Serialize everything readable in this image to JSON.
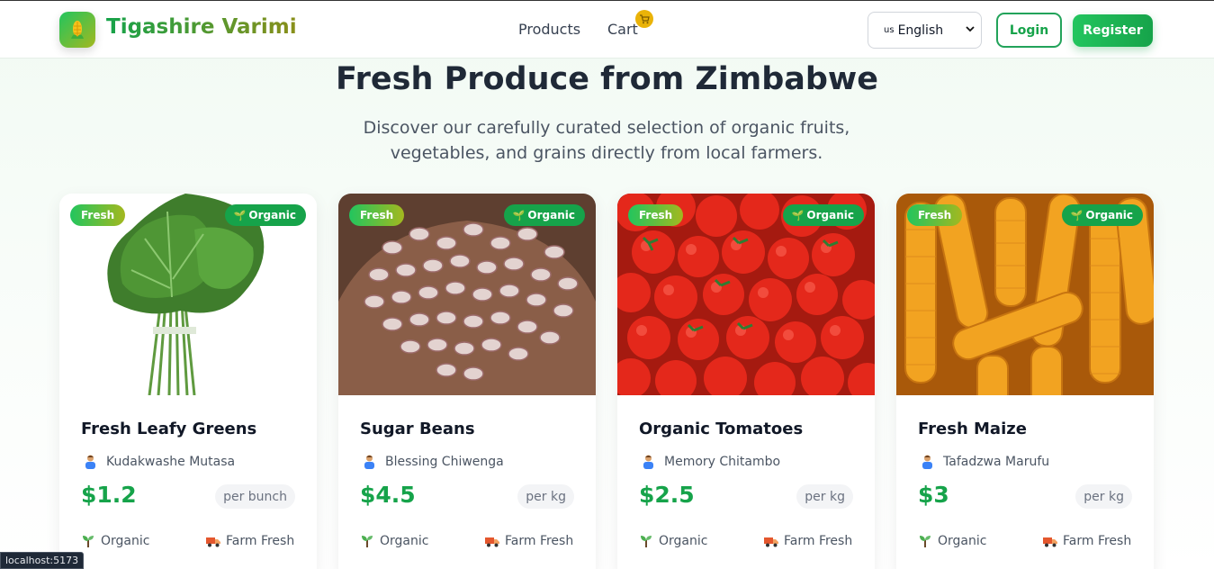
{
  "header": {
    "brand": "Tigashire Varimi",
    "nav": {
      "products": "Products",
      "cart": "Cart"
    },
    "language": {
      "code": "us",
      "selected": "English"
    },
    "login": "Login",
    "register": "Register"
  },
  "hero": {
    "title": "Fresh Produce from Zimbabwe",
    "subtitle": "Discover our carefully curated selection of organic fruits, vegetables, and grains directly from local farmers."
  },
  "products": [
    {
      "badge_fresh": "Fresh",
      "badge_organic": "Organic",
      "name": "Fresh Leafy Greens",
      "farmer": "Kudakwashe Mutasa",
      "price": "$1.2",
      "unit": "per bunch",
      "feature_1": "Organic",
      "feature_2": "Farm Fresh",
      "image": "leafy-greens"
    },
    {
      "badge_fresh": "Fresh",
      "badge_organic": "Organic",
      "name": "Sugar Beans",
      "farmer": "Blessing Chiwenga",
      "price": "$4.5",
      "unit": "per kg",
      "feature_1": "Organic",
      "feature_2": "Farm Fresh",
      "image": "sugar-beans"
    },
    {
      "badge_fresh": "Fresh",
      "badge_organic": "Organic",
      "name": "Organic Tomatoes",
      "farmer": "Memory Chitambo",
      "price": "$2.5",
      "unit": "per kg",
      "feature_1": "Organic",
      "feature_2": "Farm Fresh",
      "image": "tomatoes"
    },
    {
      "badge_fresh": "Fresh",
      "badge_organic": "Organic",
      "name": "Fresh Maize",
      "farmer": "Tafadzwa Marufu",
      "price": "$3",
      "unit": "per kg",
      "feature_1": "Organic",
      "feature_2": "Farm Fresh",
      "image": "maize"
    }
  ],
  "statusbar": {
    "url": "localhost:5173"
  },
  "colors": {
    "accent": "#16a34a",
    "brand_gradient_end": "#8a8f1a",
    "cart_badge": "#eab308"
  }
}
